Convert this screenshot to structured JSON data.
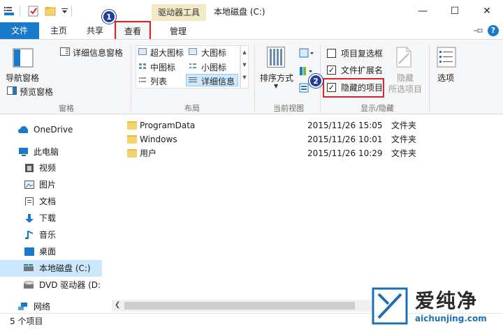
{
  "titlebar": {
    "context_tab": "驱动器工具",
    "title": "本地磁盘 (C:)",
    "minimize": "—",
    "maximize": "☐",
    "close": "✕"
  },
  "tabs": {
    "file": "文件",
    "home": "主页",
    "share": "共享",
    "view": "查看",
    "manage": "管理",
    "help": "?"
  },
  "annotations": {
    "step1": "1",
    "step2": "2"
  },
  "ribbon": {
    "panes": {
      "nav_pane": "导航窗格",
      "preview_pane": "预览窗格",
      "details_pane": "详细信息窗格",
      "group": "窗格"
    },
    "layout": {
      "xl_icons": "超大图标",
      "large_icons": "大图标",
      "medium_icons": "中图标",
      "small_icons": "小图标",
      "list": "列表",
      "details": "详细信息",
      "group": "布局"
    },
    "current_view": {
      "sort_by": "排序方式",
      "group": "当前视图"
    },
    "show_hide": {
      "item_checkboxes": "项目复选框",
      "item_checkboxes_checked": false,
      "file_extensions": "文件扩展名",
      "file_extensions_checked": true,
      "hidden_items": "隐藏的项目",
      "hidden_items_checked": true,
      "hide_selected_1": "隐藏",
      "hide_selected_2": "所选项目",
      "group": "显示/隐藏"
    },
    "options": "选项"
  },
  "nav": {
    "items": [
      {
        "label": "OneDrive",
        "icon": "cloud-icon"
      },
      {
        "label": "此电脑",
        "icon": "computer-icon"
      },
      {
        "label": "视频",
        "icon": "video-icon"
      },
      {
        "label": "图片",
        "icon": "picture-icon"
      },
      {
        "label": "文档",
        "icon": "document-icon"
      },
      {
        "label": "下载",
        "icon": "download-icon"
      },
      {
        "label": "音乐",
        "icon": "music-icon"
      },
      {
        "label": "桌面",
        "icon": "desktop-icon"
      },
      {
        "label": "本地磁盘 (C:)",
        "icon": "drive-icon"
      },
      {
        "label": "DVD 驱动器 (D:",
        "icon": "dvd-icon"
      },
      {
        "label": "网络",
        "icon": "network-icon"
      }
    ]
  },
  "files": [
    {
      "name": "ProgramData",
      "date": "2015/11/26 15:05",
      "type": "文件夹"
    },
    {
      "name": "Windows",
      "date": "2015/11/26 10:01",
      "type": "文件夹"
    },
    {
      "name": "用户",
      "date": "2015/11/26 10:29",
      "type": "文件夹"
    }
  ],
  "status": {
    "count": "5 个项目"
  },
  "watermark": {
    "brand": "爱纯净",
    "url": "aichunjing.com"
  },
  "colors": {
    "accent": "#1979ca",
    "highlight": "#d9262b",
    "badge": "#1f3f9a",
    "selection": "#cce8ff"
  }
}
